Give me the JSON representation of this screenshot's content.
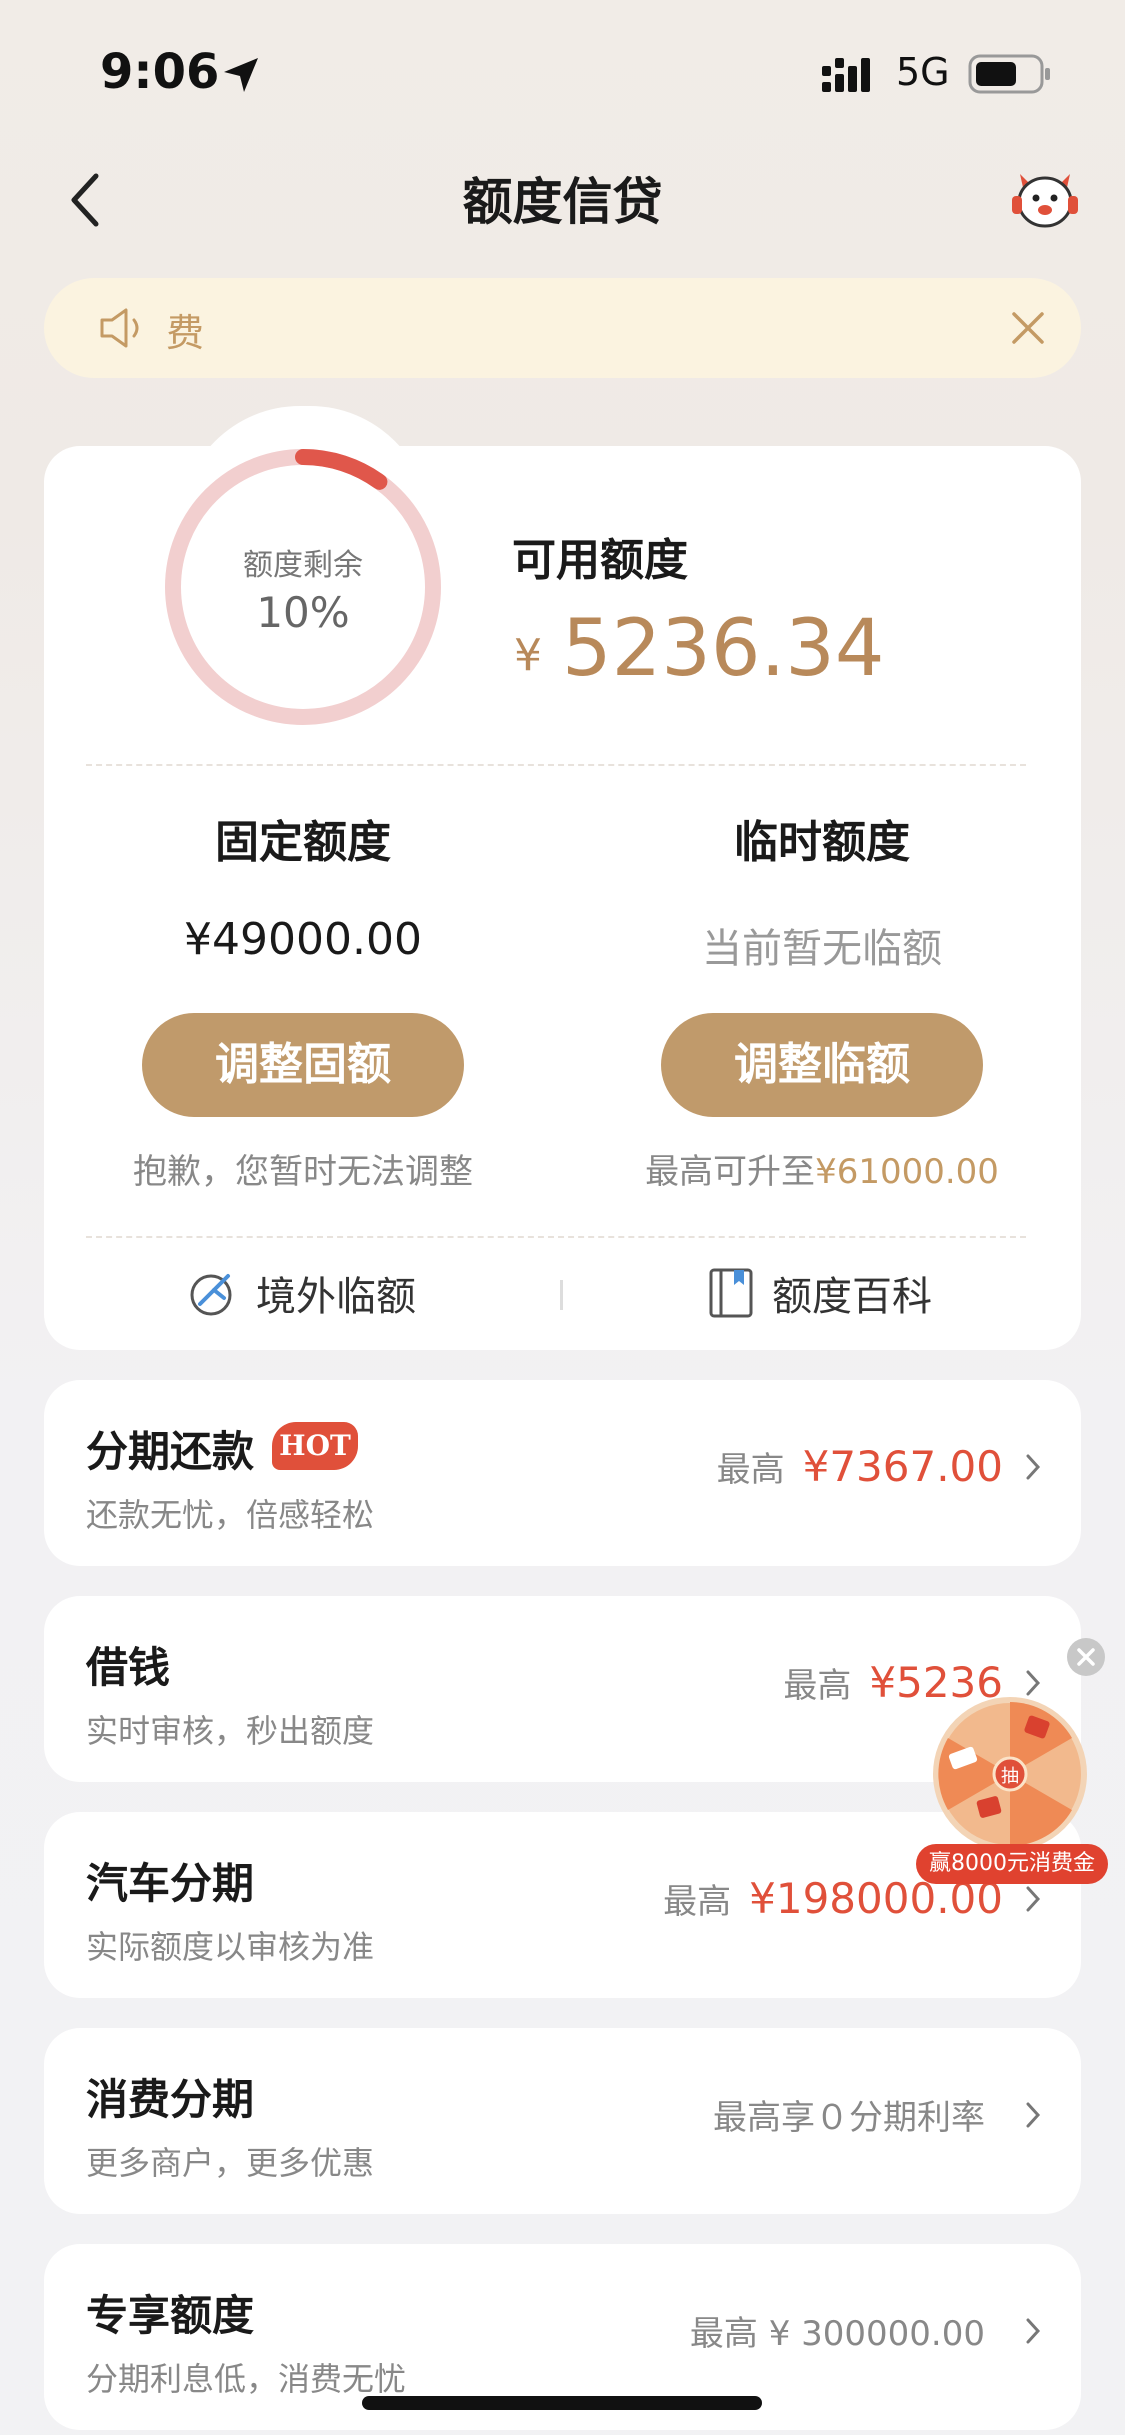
{
  "status_bar": {
    "time": "9:06",
    "network": "5G"
  },
  "nav": {
    "title": "额度信贷"
  },
  "notice": {
    "text": "费"
  },
  "credit": {
    "ring_label": "额度剩余",
    "ring_percent_text": "10%",
    "remaining_fraction": 0.1,
    "available_label": "可用额度",
    "currency": "¥",
    "available_amount": "5236.34",
    "fixed": {
      "title": "固定额度",
      "value": "¥49000.00",
      "button": "调整固额",
      "note": "抱歉，您暂时无法调整"
    },
    "temp": {
      "title": "临时额度",
      "value": "当前暂无临额",
      "button": "调整临额",
      "note_prefix": "最高可升至",
      "note_amount": "¥61000.00"
    },
    "links": {
      "overseas": "境外临额",
      "wiki": "额度百科"
    }
  },
  "rows": [
    {
      "title": "分期还款",
      "badge": "HOT",
      "subtitle": "还款无忧，倍感轻松",
      "label": "最高",
      "value": "¥7367.00"
    },
    {
      "title": "借钱",
      "subtitle": "实时审核，秒出额度",
      "label": "最高",
      "value": "¥5236"
    },
    {
      "title": "汽车分期",
      "subtitle": "实际额度以审核为准",
      "label": "最高",
      "value": "¥198000.00"
    },
    {
      "title": "消费分期",
      "subtitle": "更多商户，更多优惠",
      "label": "最高享０分期利率",
      "value": ""
    },
    {
      "title": "专享额度",
      "subtitle": "分期利息低，消费无忧",
      "label": "最高 ¥ 300000.00",
      "value": ""
    }
  ],
  "floating": {
    "center_text": "抽",
    "label": "赢8000元消费金"
  },
  "colors": {
    "accent": "#c09a6b",
    "gold_text": "#b8895a",
    "red": "#e0503a",
    "ring_track": "#f2cfcf",
    "ring_fill": "#e0574b"
  }
}
